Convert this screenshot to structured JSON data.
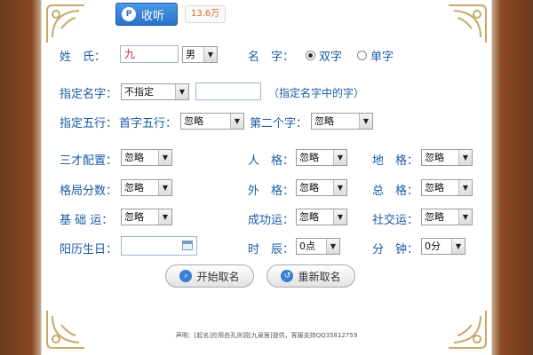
{
  "toolbar": {
    "listen_label": "收听",
    "listen_icon": "speaker-icon",
    "listen_count": "13.6万"
  },
  "form": {
    "surname_label": "姓　氏：",
    "surname_value": "九",
    "gender_value": "男",
    "name_label": "名　字：",
    "name_options": [
      "双字",
      "单字"
    ],
    "name_selected": "双字",
    "specify_label": "指定名字：",
    "specify_value": "不指定",
    "specify_text": "",
    "specify_hint": "（指定名字中的字）",
    "wuxing_label": "指定五行：",
    "first_wuxing_label": "首字五行：",
    "first_wuxing_value": "忽略",
    "second_label": "第二个字：",
    "second_value": "忽略",
    "sancai_label": "三才配置：",
    "sancai_value": "忽略",
    "renge_label": "人　格：",
    "renge_value": "忽略",
    "dige_label": "地　格：",
    "dige_value": "忽略",
    "score_label": "格局分数：",
    "score_value": "忽略",
    "waige_label": "外　格：",
    "waige_value": "忽略",
    "zongge_label": "总　格：",
    "zongge_value": "忽略",
    "jichu_label": "基 础 运：",
    "jichu_value": "忽略",
    "chenggong_label": "成功运：",
    "chenggong_value": "忽略",
    "shejiao_label": "社交运：",
    "shejiao_value": "忽略",
    "birth_label": "阳历生日：",
    "birth_value": "",
    "hour_label": "时　辰：",
    "hour_value": "0点",
    "minute_label": "分　钟：",
    "minute_value": "0分"
  },
  "actions": {
    "start_label": "开始取名",
    "restart_label": "重新取名"
  },
  "footer": {
    "text": "声明：[起名]应用由孔庆锐[九泉居]提供，客服支持QQ35812759"
  },
  "colors": {
    "accent": "#2a6fc9",
    "label": "#1a5aa6",
    "frame": "#8a4a22",
    "ornament": "#c7a96a"
  }
}
